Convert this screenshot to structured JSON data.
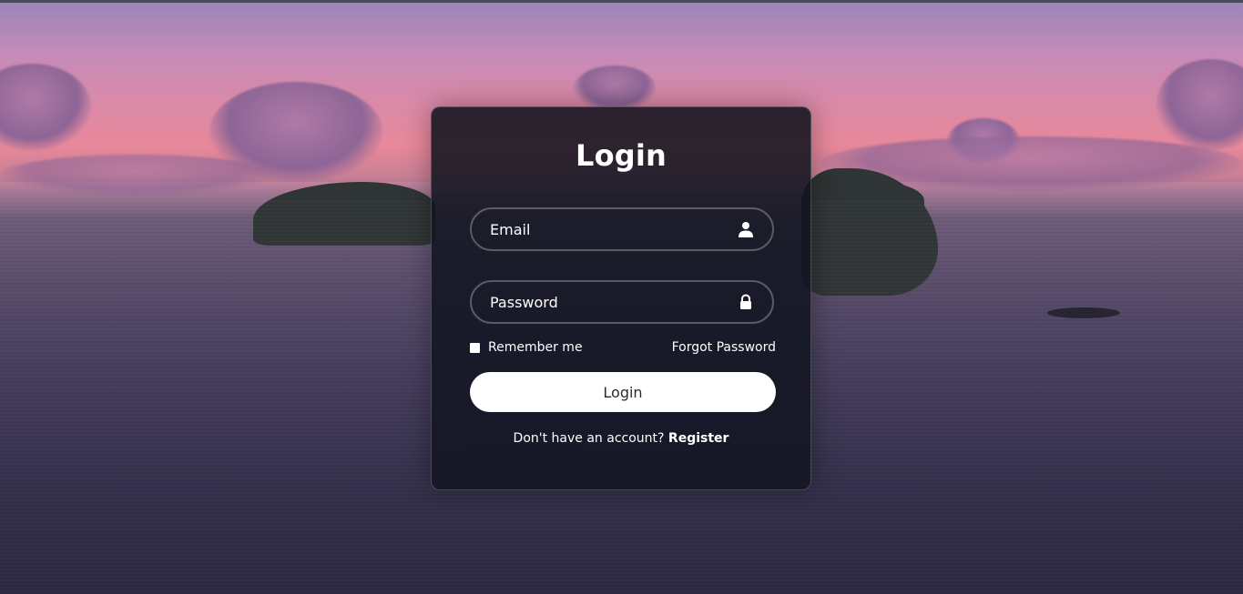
{
  "login": {
    "title": "Login",
    "email_placeholder": "Email",
    "password_placeholder": "Password",
    "remember_label": "Remember me",
    "forgot_label": "Forgot Password",
    "button_label": "Login",
    "register_prompt": "Don't have an account?",
    "register_label": "Register"
  },
  "icons": {
    "email_field": "user-icon",
    "password_field": "lock-icon"
  },
  "colors": {
    "card_background": "#141a26",
    "button_background": "#ffffff",
    "button_text": "#2b2b2b",
    "text": "#ffffff"
  }
}
